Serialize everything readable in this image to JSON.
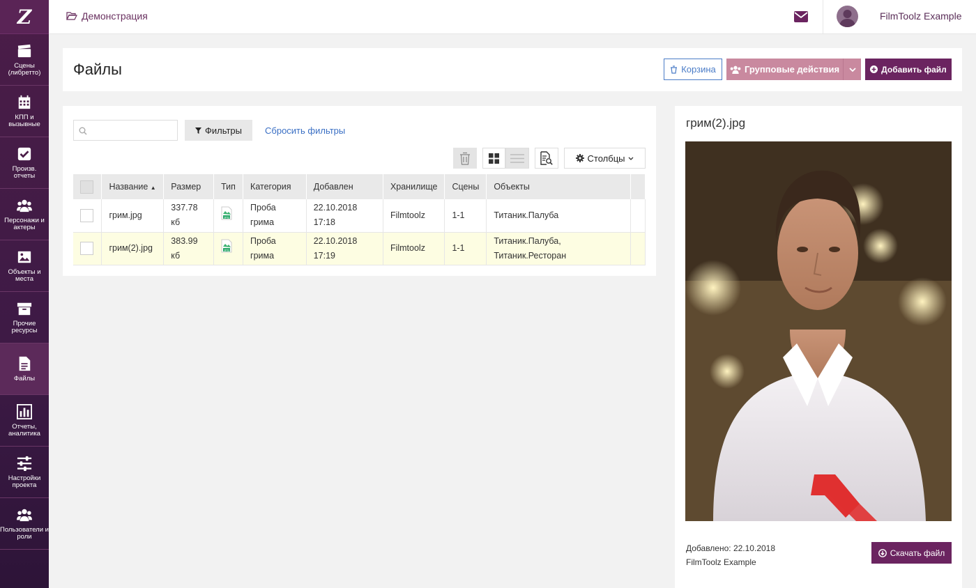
{
  "app": {
    "logo": "Z"
  },
  "sidebar": {
    "items": [
      {
        "label": "Сцены\n(либретто)",
        "icon": "clapperboard-icon"
      },
      {
        "label": "КПП и\nвызывные",
        "icon": "calendar-icon"
      },
      {
        "label": "Произв.\nотчеты",
        "icon": "checkbox-icon"
      },
      {
        "label": "Персонажи и\nактеры",
        "icon": "users-icon"
      },
      {
        "label": "Объекты и\nместа",
        "icon": "image-icon"
      },
      {
        "label": "Прочие\nресурсы",
        "icon": "archive-icon"
      },
      {
        "label": "Файлы",
        "icon": "file-icon"
      },
      {
        "label": "Отчеты,\nаналитика",
        "icon": "bar-chart-icon"
      },
      {
        "label": "Настройки\nпроекта",
        "icon": "sliders-icon"
      },
      {
        "label": "Пользователи и\nроли",
        "icon": "users-icon"
      }
    ]
  },
  "topbar": {
    "breadcrumb": "Демонстрация",
    "username": "FilmToolz Example"
  },
  "header": {
    "title": "Файлы",
    "trash_label": "Корзина",
    "group_actions_label": "Групповые действия",
    "add_file_label": "Добавить файл"
  },
  "files": {
    "search_placeholder": "",
    "filters_label": "Фильтры",
    "reset_filters_label": "Сбросить фильтры",
    "columns_label": "Столбцы",
    "table": {
      "headers": [
        "Название",
        "Размер",
        "Тип",
        "Категория",
        "Добавлен",
        "Хранилище",
        "Сцены",
        "Объекты"
      ],
      "rows": [
        {
          "name": "грим.jpg",
          "size": "337.78\nкб",
          "type": "JPG",
          "category": "Проба\nгрима",
          "added": "22.10.2018\n17:18",
          "storage": "Filmtoolz",
          "scenes": "1-1",
          "objects": "Титаник.Палуба"
        },
        {
          "name": "грим(2).jpg",
          "size": "383.99\nкб",
          "type": "JPG",
          "category": "Проба\nгрима",
          "added": "22.10.2018\n17:19",
          "storage": "Filmtoolz",
          "scenes": "1-1",
          "objects": "Титаник.Палуба,\nТитаник.Ресторан"
        }
      ]
    }
  },
  "preview": {
    "title": "грим(2).jpg",
    "added_date": "Добавлено: 22.10.2018",
    "added_by": "FilmToolz Example",
    "download_label": "Скачать файл"
  },
  "colors": {
    "brand": "#6b2460",
    "sidebar": "#4b1d48",
    "link": "#3a6fc4",
    "selected_row": "#fdfde2"
  }
}
